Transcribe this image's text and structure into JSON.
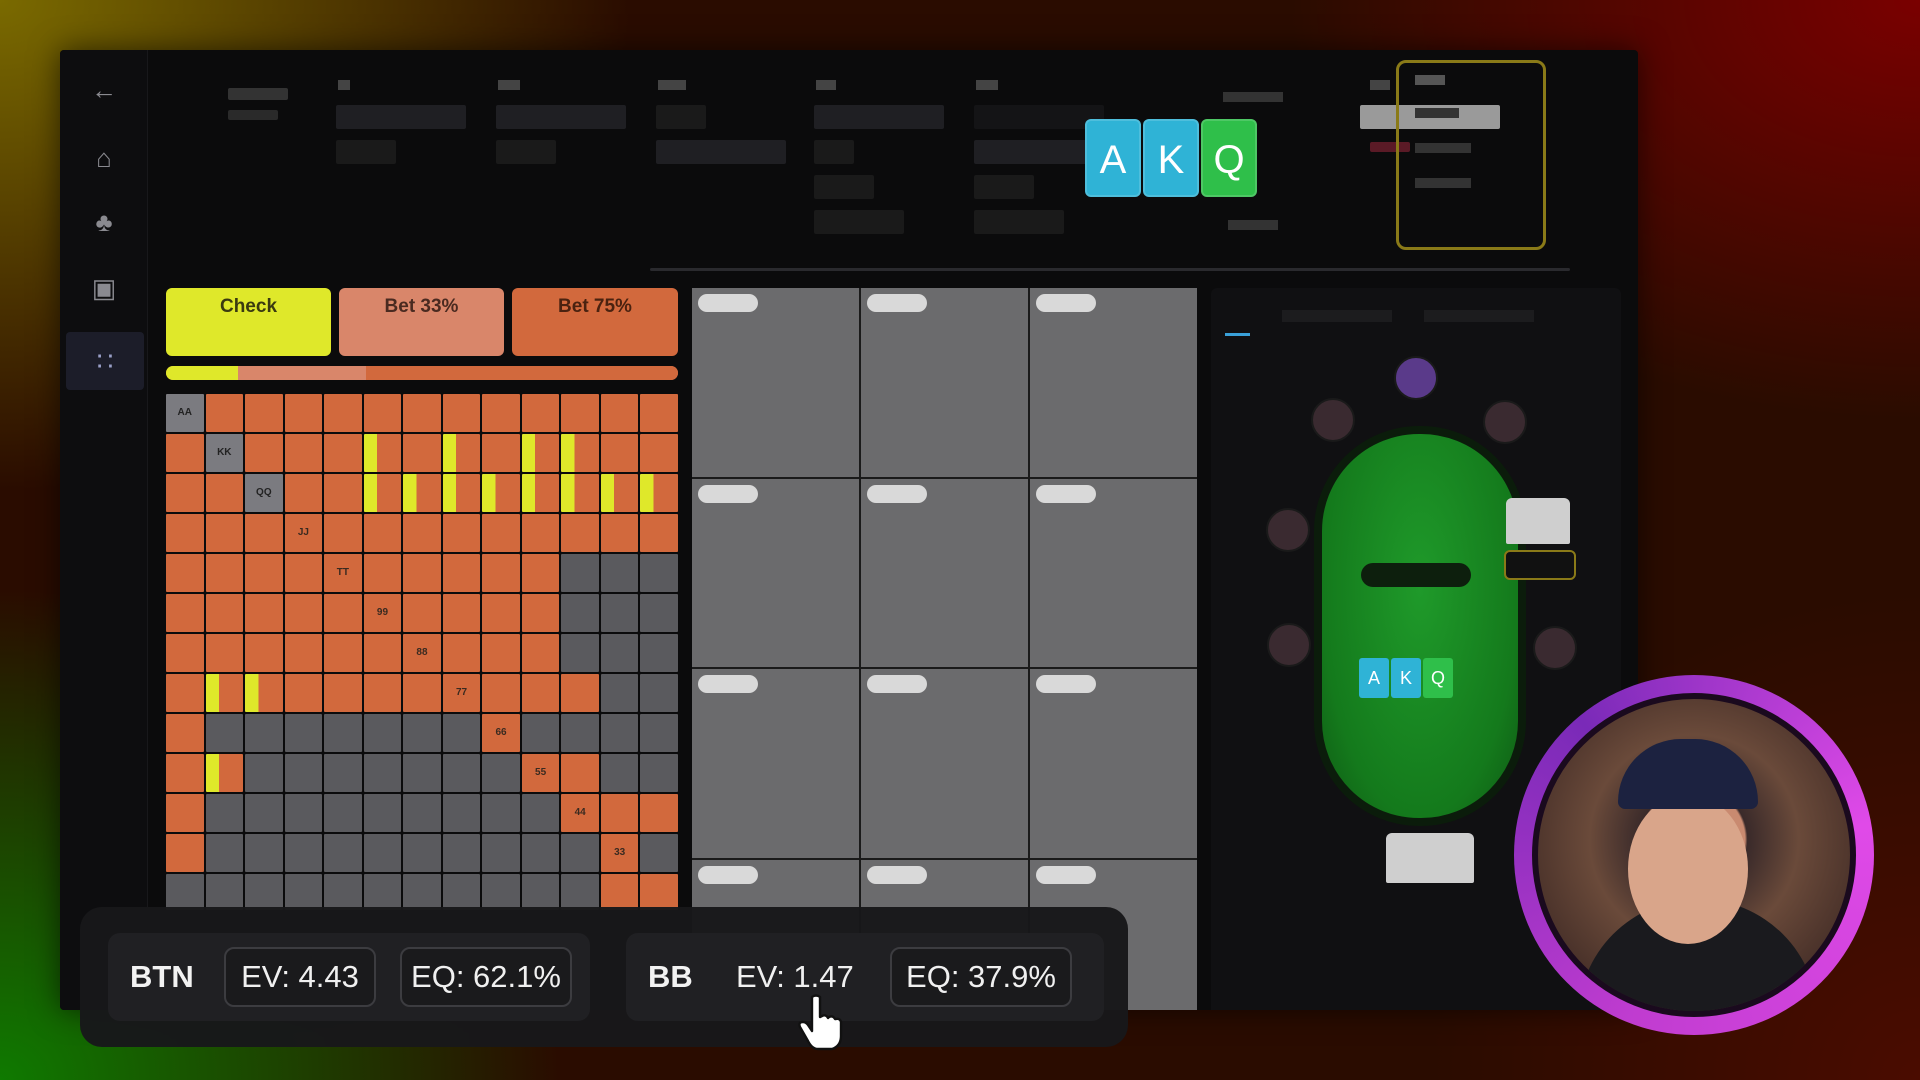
{
  "nav": {
    "icons": [
      "back-arrow-icon",
      "home-icon",
      "cards-icon",
      "gamepad-icon",
      "grid-menu-icon"
    ]
  },
  "board_cards": [
    {
      "rank": "A",
      "color": "#2fb3d6"
    },
    {
      "rank": "K",
      "color": "#2fb3d6"
    },
    {
      "rank": "Q",
      "color": "#2fbf4a"
    }
  ],
  "actions": [
    {
      "label": "Check",
      "color": "#dfe82a"
    },
    {
      "label": "Bet 33%",
      "color": "#d9866a"
    },
    {
      "label": "Bet 75%",
      "color": "#d2693d"
    }
  ],
  "grid_hands": {
    "diagonal": [
      "AA",
      "KK",
      "QQ",
      "JJ",
      "TT",
      "99",
      "88",
      "77",
      "66",
      "55",
      "44",
      "33"
    ]
  },
  "stats": {
    "btn": {
      "position": "BTN",
      "ev": "EV: 4.43",
      "eq": "EQ: 62.1%"
    },
    "bb": {
      "position": "BB",
      "ev": "EV: 1.47",
      "eq": "EQ: 37.9%"
    }
  },
  "colors": {
    "check": "#dfe82a",
    "bet_small": "#d9866a",
    "bet_large": "#d2693d",
    "table_felt": "#1f9a2a",
    "webcam_ring": "#c03cd0"
  }
}
